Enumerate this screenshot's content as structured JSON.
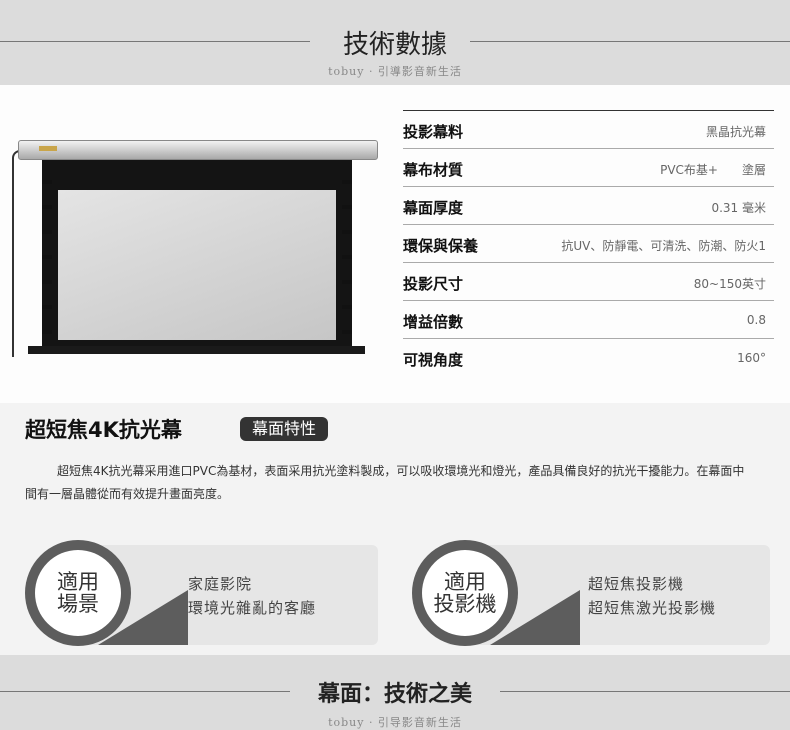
{
  "header": {
    "title": "技術數據",
    "subtitle": "tobuy · 引導影音新生活"
  },
  "specs": [
    {
      "label": "投影幕料",
      "value": "黑晶抗光幕"
    },
    {
      "label": "幕布材質",
      "value": "PVC布基+　　塗層"
    },
    {
      "label": "幕面厚度",
      "value": "0.31 毫米"
    },
    {
      "label": "環保與保養",
      "value": "抗UV、防靜電、可清洗、防潮、防火1"
    },
    {
      "label": "投影尺寸",
      "value": "80~150英寸"
    },
    {
      "label": "增益倍數",
      "value": "0.8"
    },
    {
      "label": "可視角度",
      "value": "160°"
    }
  ],
  "feature": {
    "title": "超短焦4K抗光幕",
    "badge": "幕面特性",
    "description": "超短焦4K抗光幕采用進口PVC為基材，表面采用抗光塗料製成，可以吸收環境光和燈光，產品具備良好的抗光干擾能力。在幕面中間有一層晶體從而有效提升畫面亮度。"
  },
  "cards": [
    {
      "badge_line1": "適用",
      "badge_line2": "場景",
      "line1": "家庭影院",
      "line2": "環境光雜亂的客廳"
    },
    {
      "badge_line1": "適用",
      "badge_line2": "投影機",
      "line1": "超短焦投影機",
      "line2": "超短焦激光投影機"
    }
  ],
  "footer": {
    "title": "幕面：技術之美",
    "subtitle": "tobuy · 引导影音新生活"
  },
  "colors": {
    "band": "#dcdcdc",
    "badge": "#333333",
    "circle": "#5d5d5d"
  }
}
